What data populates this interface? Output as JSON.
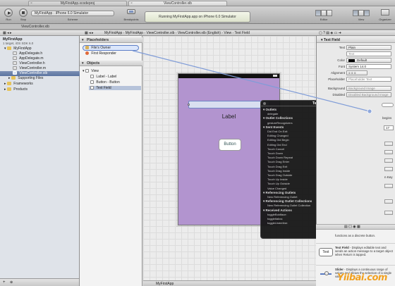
{
  "window": {
    "tabs": [
      "MyFirstApp.xcodeproj",
      "ViewController.xib"
    ],
    "doc_tab": "ViewController.xib"
  },
  "toolbar": {
    "run_label": "Run",
    "stop_label": "Stop",
    "scheme_label": "Scheme",
    "breakpoints_label": "Breakpoints",
    "scheme_target": "MyFirstApp",
    "scheme_device": "iPhone 6.0 Simulator",
    "activity_title": "Running MyFirstApp.app on iPhone 6.0 Simulator",
    "editor_label": "Editor",
    "view_label": "View",
    "organizer_label": "Organizer"
  },
  "jumpbar": {
    "crumbs": [
      "MyFirstApp",
      "MyFirstApp",
      "ViewController.xib",
      "ViewController.xib (English)",
      "View",
      "Text Field"
    ]
  },
  "navigator": {
    "project": "MyFirstApp",
    "project_sub": "1 target, iOS SDK 6.0",
    "items": [
      "MyFirstApp",
      "AppDelegate.h",
      "AppDelegate.m",
      "ViewController.h",
      "ViewController.m",
      "ViewController.xib",
      "Supporting Files",
      "Frameworks",
      "Products"
    ],
    "bottom_label": "MyFirstApp"
  },
  "outline": {
    "placeholders_header": "Placeholders",
    "placeholders": [
      "File's Owner",
      "First Responder"
    ],
    "objects_header": "Objects",
    "objects": [
      "View",
      "Label - Label",
      "Button - Button",
      "Text Field"
    ]
  },
  "canvas": {
    "label_text": "Label",
    "button_text": "Button"
  },
  "hud": {
    "title": "Text Field",
    "sections": [
      {
        "name": "Outlets",
        "rows": [
          "delegate"
        ]
      },
      {
        "name": "Outlet Collections",
        "rows": [
          "gestureRecognizers"
        ]
      },
      {
        "name": "Sent Events",
        "rows": [
          "Did End On Exit",
          "Editing Changed",
          "Editing Did Begin",
          "Editing Did End",
          "Touch Cancel",
          "Touch Down",
          "Touch Down Repeat",
          "Touch Drag Enter",
          "Touch Drag Exit",
          "Touch Drag Inside",
          "Touch Drag Outside",
          "Touch Up Inside",
          "Touch Up Outside",
          "Value Changed"
        ]
      },
      {
        "name": "Referencing Outlets",
        "rows": [
          "New Referencing Outlet"
        ]
      },
      {
        "name": "Referencing Outlet Collections",
        "rows": [
          "New Referencing Outlet Collection"
        ]
      },
      {
        "name": "Received Actions",
        "rows": [
          "toggleBoldface:",
          "toggleItalics:",
          "toggleUnderline:"
        ]
      }
    ]
  },
  "inspector": {
    "header": "Text Field",
    "rows": [
      {
        "label": "Text",
        "value": "Plain"
      },
      {
        "label": "",
        "value": "Text"
      },
      {
        "label": "Color",
        "value": "Default"
      },
      {
        "label": "Font",
        "value": "System 14.0"
      },
      {
        "label": "Alignment",
        "value": ""
      },
      {
        "label": "Placeholder",
        "value": "Placeholder Text"
      },
      {
        "label": "Background",
        "value": "Background Image"
      },
      {
        "label": "Disabled",
        "value": "Disabled Background Image"
      }
    ],
    "partial_begins": "begins",
    "partial_value": "17",
    "partial_key": "n Key"
  },
  "library": {
    "items": [
      {
        "icon": "",
        "title": "",
        "desc": "functions as a discrete button."
      },
      {
        "icon": "Text",
        "title": "Text Field",
        "desc": "Displays editable text and sends an action message to a target object when Return is tapped."
      },
      {
        "icon": "",
        "title": "Slider",
        "desc": "Displays a continuous range of values and allows the selection of a single value."
      }
    ]
  },
  "watermark": "Yiibai.com"
}
